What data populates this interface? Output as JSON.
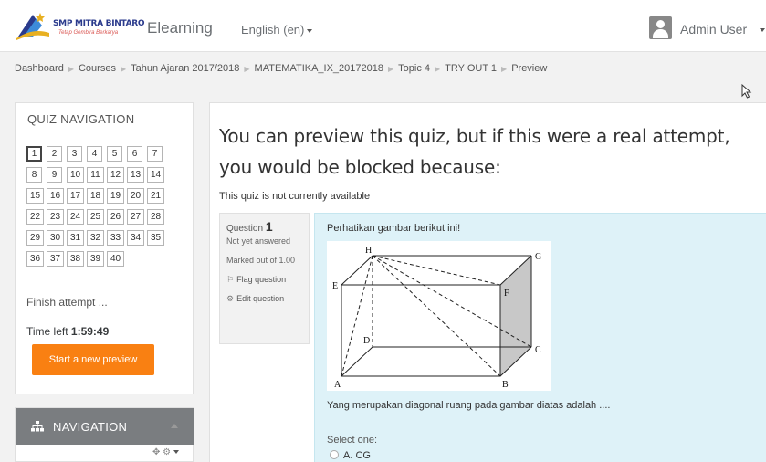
{
  "navbar": {
    "logo_line1": "SMP MITRA BINTARO",
    "logo_line2": "Tetap Gembira Berkarya",
    "brand": "Elearning",
    "language": "English (en)",
    "user_name": "Admin User"
  },
  "breadcrumb": [
    "Dashboard",
    "Courses",
    "Tahun Ajaran 2017/2018",
    "MATEMATIKA_IX_20172018",
    "Topic 4",
    "TRY OUT 1",
    "Preview"
  ],
  "quiz_navigation": {
    "title": "QUIZ NAVIGATION",
    "questions": [
      "1",
      "2",
      "3",
      "4",
      "5",
      "6",
      "7",
      "8",
      "9",
      "10",
      "11",
      "12",
      "13",
      "14",
      "15",
      "16",
      "17",
      "18",
      "19",
      "20",
      "21",
      "22",
      "23",
      "24",
      "25",
      "26",
      "27",
      "28",
      "29",
      "30",
      "31",
      "32",
      "33",
      "34",
      "35",
      "36",
      "37",
      "38",
      "39",
      "40"
    ],
    "current_question": "1",
    "finish_label": "Finish attempt ...",
    "time_left_label": "Time left",
    "time_left_value": "1:59:49",
    "start_preview_label": "Start a new preview"
  },
  "navigation_block": {
    "title": "NAVIGATION"
  },
  "main": {
    "heading": "You can preview this quiz, but if this were a real attempt, you would be blocked because:",
    "notice": "This quiz is not currently available",
    "question": {
      "number_label": "Question",
      "number": "1",
      "state": "Not yet answered",
      "marked_out_of": "Marked out of 1.00",
      "flag_label": "Flag question",
      "edit_label": "Edit question",
      "intro_text": "Perhatikan gambar berikut ini!",
      "figure_labels": [
        "H",
        "G",
        "E",
        "F",
        "D",
        "C",
        "A",
        "B"
      ],
      "question_text": "Yang merupakan diagonal ruang pada gambar diatas adalah ....",
      "select_label": "Select one:",
      "options": [
        "A. CG"
      ]
    }
  },
  "colors": {
    "accent": "#f98012",
    "question_bg": "#def2f8",
    "nav_header": "#7a7d80"
  }
}
